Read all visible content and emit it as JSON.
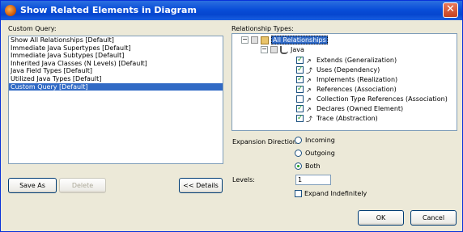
{
  "window": {
    "title": "Show Related Elements in Diagram"
  },
  "custom_query": {
    "label": "Custom Query:",
    "items": [
      {
        "label": "Show All Relationships [Default]",
        "selected": false
      },
      {
        "label": "Immediate Java Supertypes [Default]",
        "selected": false
      },
      {
        "label": "Immediate Java Subtypes [Default]",
        "selected": false
      },
      {
        "label": "Inherited Java Classes (N Levels) [Default]",
        "selected": false
      },
      {
        "label": "Java Field Types [Default]",
        "selected": false
      },
      {
        "label": "Utilized Java Types [Default]",
        "selected": false
      },
      {
        "label": "Custom Query [Default]",
        "selected": true
      }
    ]
  },
  "buttons": {
    "save_as": "Save As",
    "delete": "Delete",
    "details": "<< Details",
    "ok": "OK",
    "cancel": "Cancel"
  },
  "relationship_types": {
    "label": "Relationship Types:",
    "root": "All Relationships",
    "group": "Java",
    "items": [
      {
        "label": "Extends (Generalization)",
        "checked": true
      },
      {
        "label": "Uses (Dependency)",
        "checked": true
      },
      {
        "label": "Implements (Realization)",
        "checked": true
      },
      {
        "label": "References (Association)",
        "checked": true
      },
      {
        "label": "Collection Type References (Association)",
        "checked": false
      },
      {
        "label": "Declares (Owned Element)",
        "checked": true
      },
      {
        "label": "Trace (Abstraction)",
        "checked": true
      }
    ]
  },
  "expansion": {
    "label": "Expansion Direction:",
    "options": [
      "Incoming",
      "Outgoing",
      "Both"
    ],
    "selected": "Both"
  },
  "levels": {
    "label": "Levels:",
    "value": "1",
    "expand_indefinitely_label": "Expand Indefinitely",
    "expand_indefinitely": false
  }
}
